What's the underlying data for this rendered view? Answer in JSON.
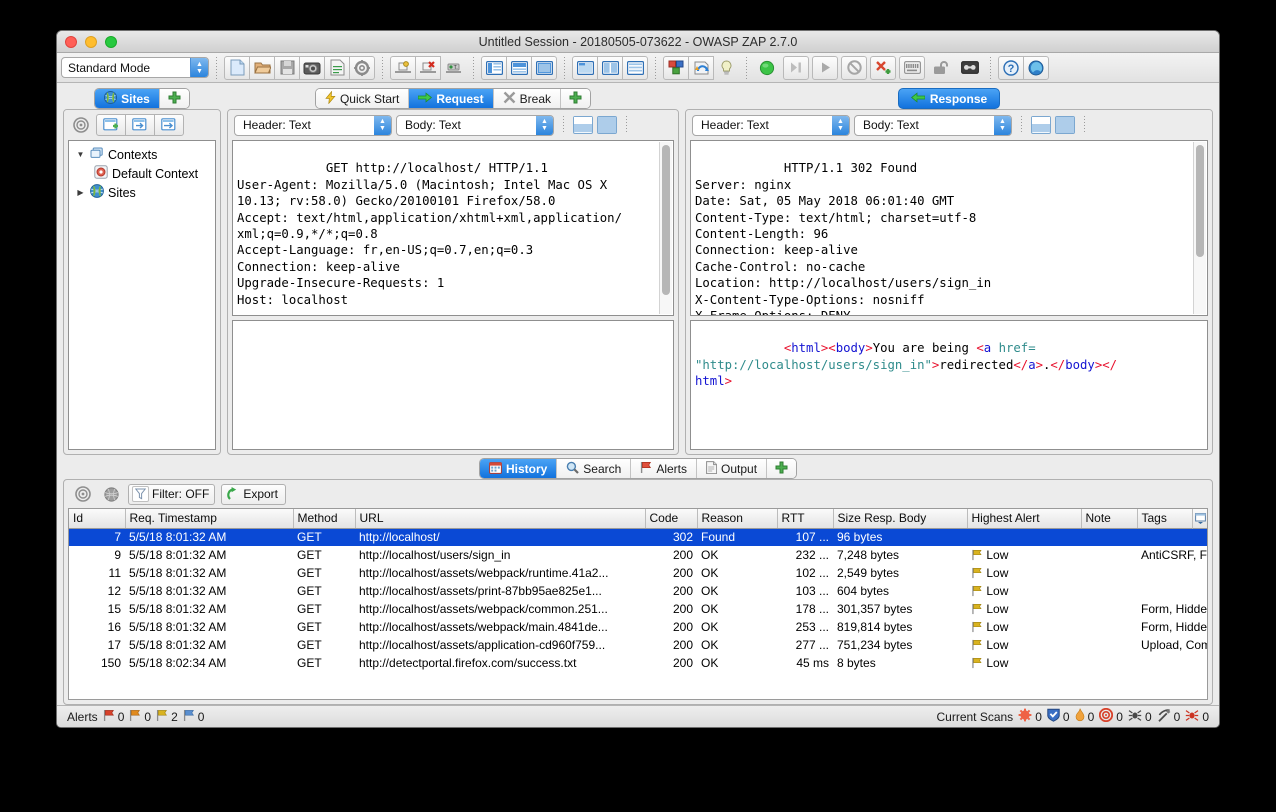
{
  "window": {
    "title": "Untitled Session - 20180505-073622 - OWASP ZAP 2.7.0"
  },
  "toolbar": {
    "mode_value": "Standard Mode",
    "buttons": [
      {
        "name": "new-session",
        "icon": "new-file-icon"
      },
      {
        "name": "open-session",
        "icon": "open-folder-icon"
      },
      {
        "name": "save-session",
        "icon": "save-disk-icon"
      },
      {
        "name": "session-properties",
        "icon": "camera-icon"
      },
      {
        "name": "session-report",
        "icon": "report-icon"
      },
      {
        "name": "options",
        "icon": "gear-icon"
      },
      {
        "name": "show-all-tabs",
        "icon": "tabs-show-icon"
      },
      {
        "name": "hide-all-tabs",
        "icon": "tabs-hide-icon"
      },
      {
        "name": "tab-text-toggle",
        "icon": "tab-text-icon"
      },
      {
        "name": "layout-full",
        "icon": "layout-full-icon"
      },
      {
        "name": "layout-split",
        "icon": "layout-split-icon"
      },
      {
        "name": "layout-wide",
        "icon": "layout-wide-icon"
      },
      {
        "name": "expand-sites",
        "icon": "expand-sites-icon"
      },
      {
        "name": "expand-columns",
        "icon": "expand-columns-icon"
      },
      {
        "name": "expand-rows",
        "icon": "expand-rows-icon"
      },
      {
        "name": "add-on-manage",
        "icon": "blocks-icon"
      },
      {
        "name": "check-updates",
        "icon": "refresh-icon"
      },
      {
        "name": "tips-and-tricks",
        "icon": "lightbulb-icon"
      },
      {
        "name": "set-break",
        "icon": "green-circle-icon"
      },
      {
        "name": "step",
        "icon": "step-icon"
      },
      {
        "name": "continue",
        "icon": "play-icon"
      },
      {
        "name": "drop",
        "icon": "drop-icon"
      },
      {
        "name": "break-sites",
        "icon": "scissors-icon"
      },
      {
        "name": "keyboard",
        "icon": "keyboard-icon"
      },
      {
        "name": "lock",
        "icon": "padlock-icon"
      },
      {
        "name": "cassette",
        "icon": "cassette-icon"
      },
      {
        "name": "help",
        "icon": "question-icon"
      },
      {
        "name": "browser-launch",
        "icon": "browser-icon"
      }
    ]
  },
  "sites_panel": {
    "tab_label": "Sites",
    "tab_icon": "globe-icon",
    "add_tab_icon": "plus-icon",
    "tools": [
      {
        "name": "scope-target",
        "icon": "target-icon"
      },
      {
        "name": "new-context",
        "icon": "new-context-icon"
      },
      {
        "name": "import-context",
        "icon": "import-context-icon"
      },
      {
        "name": "export-context",
        "icon": "export-context-icon"
      }
    ],
    "tree": [
      {
        "label": "Contexts",
        "icon": "contexts-icon",
        "expanded": true,
        "indent": 0,
        "arrow": "down"
      },
      {
        "label": "Default Context",
        "icon": "default-context-icon",
        "indent": 1,
        "arrow": "none"
      },
      {
        "label": "Sites",
        "icon": "globe-icon",
        "expanded": false,
        "indent": 0,
        "arrow": "right"
      }
    ]
  },
  "request_panel": {
    "tabs": [
      {
        "label": "Quick Start",
        "icon": "lightning-icon",
        "active": false
      },
      {
        "label": "Request",
        "icon": "arrow-right-icon",
        "active": true
      },
      {
        "label": "Break",
        "icon": "break-x-icon",
        "active": false
      }
    ],
    "add_tab_icon": "plus-icon",
    "header_combo": "Header: Text",
    "body_combo": "Body: Text",
    "view_buttons": [
      {
        "name": "split-view-button",
        "icon": "split-view-icon"
      },
      {
        "name": "single-view-button",
        "icon": "single-view-icon"
      }
    ],
    "header_text": "GET http://localhost/ HTTP/1.1\nUser-Agent: Mozilla/5.0 (Macintosh; Intel Mac OS X\n10.13; rv:58.0) Gecko/20100101 Firefox/58.0\nAccept: text/html,application/xhtml+xml,application/\nxml;q=0.9,*/*;q=0.8\nAccept-Language: fr,en-US;q=0.7,en;q=0.3\nConnection: keep-alive\nUpgrade-Insecure-Requests: 1\nHost: localhost",
    "body_text": ""
  },
  "response_panel": {
    "tab_label": "Response",
    "tab_icon": "arrow-left-icon",
    "header_combo": "Header: Text",
    "body_combo": "Body: Text",
    "view_buttons": [
      {
        "name": "split-view-button",
        "icon": "split-view-icon"
      },
      {
        "name": "single-view-button",
        "icon": "single-view-icon"
      }
    ],
    "header_text": "HTTP/1.1 302 Found\nServer: nginx\nDate: Sat, 05 May 2018 06:01:40 GMT\nContent-Type: text/html; charset=utf-8\nContent-Length: 96\nConnection: keep-alive\nCache-Control: no-cache\nLocation: http://localhost/users/sign_in\nX-Content-Type-Options: nosniff\nX-Frame-Options: DENY",
    "body_tokens": [
      {
        "t": "<",
        "c": "br"
      },
      {
        "t": "html",
        "c": "tag"
      },
      {
        "t": ">",
        "c": "br"
      },
      {
        "t": "<",
        "c": "br"
      },
      {
        "t": "body",
        "c": "tag"
      },
      {
        "t": ">",
        "c": "br"
      },
      {
        "t": "You are being ",
        "c": "txt"
      },
      {
        "t": "<",
        "c": "br"
      },
      {
        "t": "a ",
        "c": "tag"
      },
      {
        "t": "href=\n\"http://localhost/users/sign_in\"",
        "c": "attr"
      },
      {
        "t": ">",
        "c": "br"
      },
      {
        "t": "redirected",
        "c": "txt"
      },
      {
        "t": "</",
        "c": "br"
      },
      {
        "t": "a",
        "c": "tag"
      },
      {
        "t": ">",
        "c": "br"
      },
      {
        "t": ".",
        "c": "txt"
      },
      {
        "t": "</",
        "c": "br"
      },
      {
        "t": "body",
        "c": "tag"
      },
      {
        "t": ">",
        "c": "br"
      },
      {
        "t": "</\n",
        "c": "br"
      },
      {
        "t": "html",
        "c": "tag"
      },
      {
        "t": ">",
        "c": "br"
      }
    ]
  },
  "bottom_panel": {
    "tabs": [
      {
        "label": "History",
        "icon": "calendar-icon",
        "active": true
      },
      {
        "label": "Search",
        "icon": "magnifier-icon",
        "active": false
      },
      {
        "label": "Alerts",
        "icon": "flag-red-icon",
        "active": false
      },
      {
        "label": "Output",
        "icon": "document-icon",
        "active": false
      }
    ],
    "add_tab_icon": "plus-icon",
    "tools": {
      "scope_icon": "target-icon",
      "globe_icon": "globe-grey-icon",
      "filter_icon": "funnel-icon",
      "filter_label": "Filter: OFF",
      "export_icon": "export-arrow-icon",
      "export_label": "Export"
    },
    "columns": [
      "Id",
      "Req. Timestamp",
      "Method",
      "URL",
      "Code",
      "Reason",
      "RTT",
      "Size Resp. Body",
      "Highest Alert",
      "Note",
      "Tags"
    ],
    "rows": [
      {
        "selected": true,
        "id": "7",
        "timestamp": "5/5/18 8:01:32 AM",
        "method": "GET",
        "url": "http://localhost/",
        "code": "302",
        "reason": "Found",
        "rtt": "107 ...",
        "size": "96 bytes",
        "alert": "",
        "alert_icon": "",
        "note": "",
        "tags": ""
      },
      {
        "selected": false,
        "id": "9",
        "timestamp": "5/5/18 8:01:32 AM",
        "method": "GET",
        "url": "http://localhost/users/sign_in",
        "code": "200",
        "reason": "OK",
        "rtt": "232 ...",
        "size": "7,248 bytes",
        "alert": "Low",
        "alert_icon": "flag-yellow-icon",
        "note": "",
        "tags": "AntiCSRF, Form, Pa..."
      },
      {
        "selected": false,
        "id": "11",
        "timestamp": "5/5/18 8:01:32 AM",
        "method": "GET",
        "url": "http://localhost/assets/webpack/runtime.41a2...",
        "code": "200",
        "reason": "OK",
        "rtt": "102 ...",
        "size": "2,549 bytes",
        "alert": "Low",
        "alert_icon": "flag-yellow-icon",
        "note": "",
        "tags": ""
      },
      {
        "selected": false,
        "id": "12",
        "timestamp": "5/5/18 8:01:32 AM",
        "method": "GET",
        "url": "http://localhost/assets/print-87bb95ae825e1...",
        "code": "200",
        "reason": "OK",
        "rtt": "103 ...",
        "size": "604 bytes",
        "alert": "Low",
        "alert_icon": "flag-yellow-icon",
        "note": "",
        "tags": ""
      },
      {
        "selected": false,
        "id": "15",
        "timestamp": "5/5/18 8:01:32 AM",
        "method": "GET",
        "url": "http://localhost/assets/webpack/common.251...",
        "code": "200",
        "reason": "OK",
        "rtt": "178 ...",
        "size": "301,357 bytes",
        "alert": "Low",
        "alert_icon": "flag-yellow-icon",
        "note": "",
        "tags": "Form, Hidden, Uplo..."
      },
      {
        "selected": false,
        "id": "16",
        "timestamp": "5/5/18 8:01:32 AM",
        "method": "GET",
        "url": "http://localhost/assets/webpack/main.4841de...",
        "code": "200",
        "reason": "OK",
        "rtt": "253 ...",
        "size": "819,814 bytes",
        "alert": "Low",
        "alert_icon": "flag-yellow-icon",
        "note": "",
        "tags": "Form, Hidden, Uplo..."
      },
      {
        "selected": false,
        "id": "17",
        "timestamp": "5/5/18 8:01:32 AM",
        "method": "GET",
        "url": "http://localhost/assets/application-cd960f759...",
        "code": "200",
        "reason": "OK",
        "rtt": "277 ...",
        "size": "751,234 bytes",
        "alert": "Low",
        "alert_icon": "flag-yellow-icon",
        "note": "",
        "tags": "Upload, Comment"
      },
      {
        "selected": false,
        "id": "150",
        "timestamp": "5/5/18 8:02:34 AM",
        "method": "GET",
        "url": "http://detectportal.firefox.com/success.txt",
        "code": "200",
        "reason": "OK",
        "rtt": "45 ms",
        "size": "8 bytes",
        "alert": "Low",
        "alert_icon": "flag-yellow-icon",
        "note": "",
        "tags": ""
      }
    ],
    "column-chooser_icon": "column-chooser-icon"
  },
  "statusbar": {
    "alerts_label": "Alerts",
    "alerts": [
      {
        "icon": "flag-red-icon",
        "color": "#d8412a",
        "count": "0"
      },
      {
        "icon": "flag-orange-icon",
        "color": "#e08a1e",
        "count": "0"
      },
      {
        "icon": "flag-yellow-icon",
        "color": "#d9b320",
        "count": "2"
      },
      {
        "icon": "flag-blue-icon",
        "color": "#5a8fd0",
        "count": "0"
      }
    ],
    "scans_label": "Current Scans",
    "scans": [
      {
        "icon": "spider-sun-icon",
        "color": "#ef6245",
        "count": "0"
      },
      {
        "icon": "shield-icon",
        "color": "#3a6fc4",
        "count": "0"
      },
      {
        "icon": "flame-icon",
        "color": "#f0a23c",
        "count": "0"
      },
      {
        "icon": "target-icon",
        "color": "#d8412a",
        "count": "0"
      },
      {
        "icon": "ajax-spider-icon",
        "color": "#555555",
        "count": "0"
      },
      {
        "icon": "pickaxe-icon",
        "color": "#4a4a4a",
        "count": "0"
      },
      {
        "icon": "spider-red-icon",
        "color": "#cc3322",
        "count": "0"
      }
    ]
  }
}
